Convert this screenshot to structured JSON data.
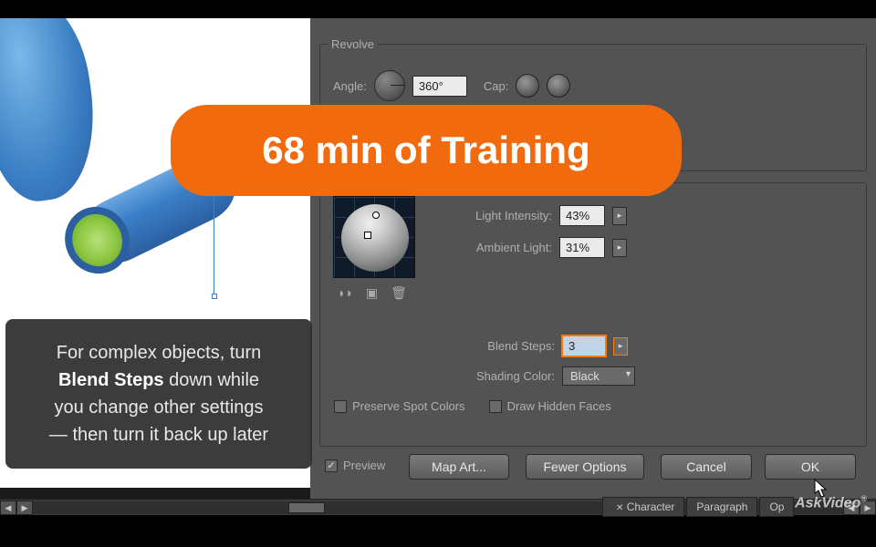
{
  "banner": {
    "text": "68 min of Training"
  },
  "tip": {
    "line1": "For complex objects, turn",
    "bold": "Blend Steps",
    "line2_rest": " down while",
    "line3": "you change other settings",
    "line4": "— then turn it back up later"
  },
  "dialog": {
    "revolve": {
      "title": "Revolve",
      "angle_label": "Angle:",
      "angle_value": "360°",
      "cap_label": "Cap:"
    },
    "surface": {
      "light_intensity_label": "Light Intensity:",
      "light_intensity_value": "43%",
      "ambient_light_label": "Ambient Light:",
      "ambient_light_value": "31%",
      "blend_steps_label": "Blend Steps:",
      "blend_steps_value": "3",
      "shading_color_label": "Shading Color:",
      "shading_color_value": "Black",
      "preserve_spot_label": "Preserve Spot Colors",
      "draw_hidden_label": "Draw Hidden Faces"
    },
    "footer": {
      "preview_label": "Preview",
      "map_art": "Map Art...",
      "fewer_options": "Fewer Options",
      "cancel": "Cancel",
      "ok": "OK"
    }
  },
  "panel_tabs": {
    "character": "Character",
    "paragraph": "Paragraph",
    "opentype": "Op"
  },
  "watermark": "AskVideo",
  "colors": {
    "accent": "#f26a0e",
    "dialog_bg": "#535353"
  }
}
